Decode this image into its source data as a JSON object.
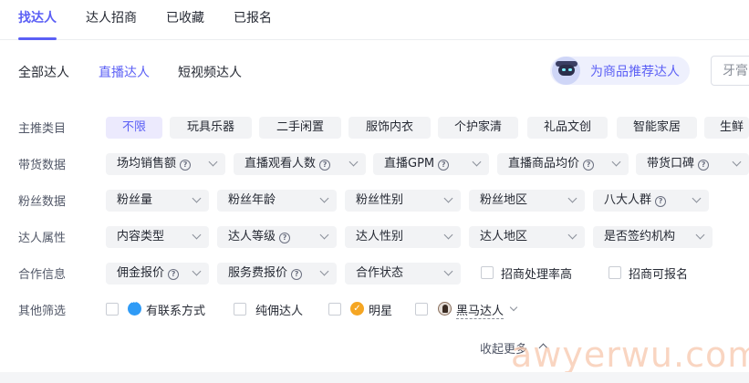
{
  "tabs": [
    {
      "label": "找达人",
      "active": true
    },
    {
      "label": "达人招商",
      "active": false
    },
    {
      "label": "已收藏",
      "active": false
    },
    {
      "label": "已报名",
      "active": false
    }
  ],
  "subtabs": [
    {
      "label": "全部达人",
      "active": false
    },
    {
      "label": "直播达人",
      "active": true
    },
    {
      "label": "短视频达人",
      "active": false
    }
  ],
  "recommend_button": {
    "label": "为商品推荐达人",
    "icon": "robot-avatar-icon"
  },
  "search": {
    "placeholder": "牙膏"
  },
  "filters": {
    "category": {
      "label": "主推类目",
      "chips": [
        "不限",
        "玩具乐器",
        "二手闲置",
        "服饰内衣",
        "个护家清",
        "礼品文创",
        "智能家居",
        "生鲜"
      ]
    },
    "sales": {
      "label": "带货数据",
      "dropdowns": [
        "场均销售额",
        "直播观看人数",
        "直播GPM",
        "直播商品均价",
        "带货口碑"
      ]
    },
    "fans": {
      "label": "粉丝数据",
      "dropdowns": [
        "粉丝量",
        "粉丝年龄",
        "粉丝性别",
        "粉丝地区",
        "八大人群"
      ]
    },
    "attributes": {
      "label": "达人属性",
      "dropdowns": [
        "内容类型",
        "达人等级",
        "达人性别",
        "达人地区",
        "是否签约机构"
      ]
    },
    "cooperation": {
      "label": "合作信息",
      "dropdowns": [
        "佣金报价",
        "服务费报价",
        "合作状态"
      ],
      "checkboxes": [
        "招商处理率高",
        "招商可报名"
      ]
    },
    "others": {
      "label": "其他筛选",
      "checkboxes": [
        "有联系方式",
        "纯佣达人",
        "明星",
        "黑马达人"
      ]
    }
  },
  "collapse_label": "收起更多",
  "watermark": "awyerwu.com",
  "colors": {
    "accent": "#5b5ff5",
    "chip_bg": "#f2f3f5",
    "active_chip_bg": "#eceafd"
  }
}
